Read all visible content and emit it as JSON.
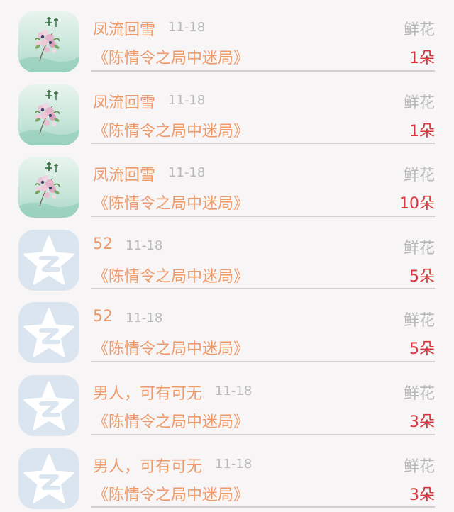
{
  "items": [
    {
      "name": "凤流回雪",
      "date": "11-18",
      "gift_type": "鲜花",
      "title": "《陈情令之局中迷局》",
      "count": "1朵",
      "avatar": "flower-painting-avatar"
    },
    {
      "name": "凤流回雪",
      "date": "11-18",
      "gift_type": "鲜花",
      "title": "《陈情令之局中迷局》",
      "count": "1朵",
      "avatar": "flower-painting-avatar"
    },
    {
      "name": "凤流回雪",
      "date": "11-18",
      "gift_type": "鲜花",
      "title": "《陈情令之局中迷局》",
      "count": "10朵",
      "avatar": "flower-painting-avatar"
    },
    {
      "name": "52",
      "date": "11-18",
      "gift_type": "鲜花",
      "title": "《陈情令之局中迷局》",
      "count": "5朵",
      "avatar": "qzone-star-avatar"
    },
    {
      "name": "52",
      "date": "11-18",
      "gift_type": "鲜花",
      "title": "《陈情令之局中迷局》",
      "count": "5朵",
      "avatar": "qzone-star-avatar"
    },
    {
      "name": "男人，可有可无",
      "date": "11-18",
      "gift_type": "鲜花",
      "title": "《陈情令之局中迷局》",
      "count": "3朵",
      "avatar": "qzone-star-avatar"
    },
    {
      "name": "男人，可有可无",
      "date": "11-18",
      "gift_type": "鲜花",
      "title": "《陈情令之局中迷局》",
      "count": "3朵",
      "avatar": "qzone-star-avatar"
    }
  ],
  "colors": {
    "name": "#ef9a6a",
    "meta": "#b8b8b8",
    "count": "#d9363e",
    "divider": "#cfcfcf",
    "background": "#f7f5f6"
  }
}
